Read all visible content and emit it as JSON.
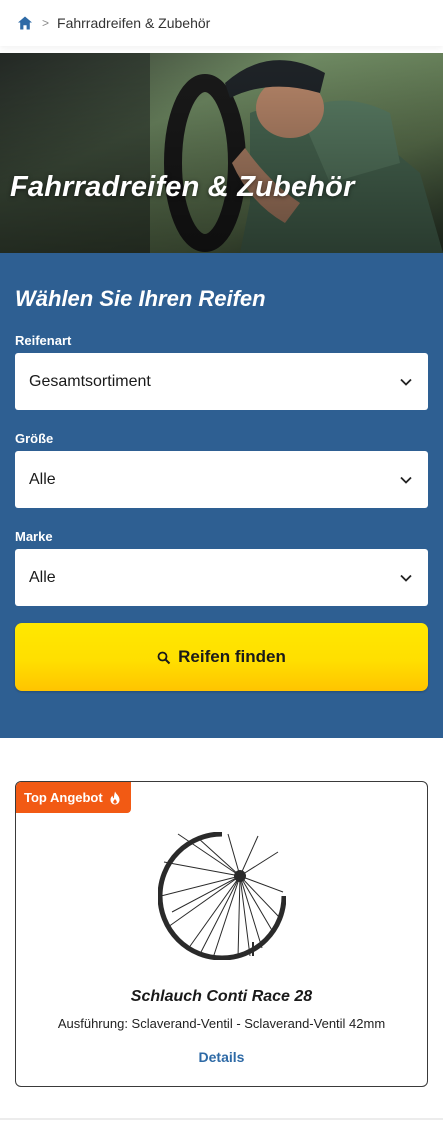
{
  "breadcrumb": {
    "home_icon": "home-icon",
    "separator": ">",
    "current": "Fahrradreifen & Zubehör"
  },
  "hero": {
    "title": "Fahrradreifen & Zubehör"
  },
  "finder": {
    "heading": "Wählen Sie Ihren Reifen",
    "fields": [
      {
        "label": "Reifenart",
        "value": "Gesamtsortiment"
      },
      {
        "label": "Größe",
        "value": "Alle"
      },
      {
        "label": "Marke",
        "value": "Alle"
      }
    ],
    "button_label": "Reifen finden",
    "button_icon": "search-icon"
  },
  "offer": {
    "badge": "Top Angebot",
    "badge_icon": "flame-icon",
    "product_image": "bicycle-wheel-image",
    "title": "Schlauch Conti Race 28",
    "description": "Ausführung: Sclaverand-Ventil - Sclaverand-Ventil 42mm",
    "link_label": "Details"
  },
  "colors": {
    "primary_blue": "#2e5f92",
    "link_blue": "#2e6aa6",
    "cta_yellow": "#ffe000",
    "badge_orange": "#f25a14"
  }
}
